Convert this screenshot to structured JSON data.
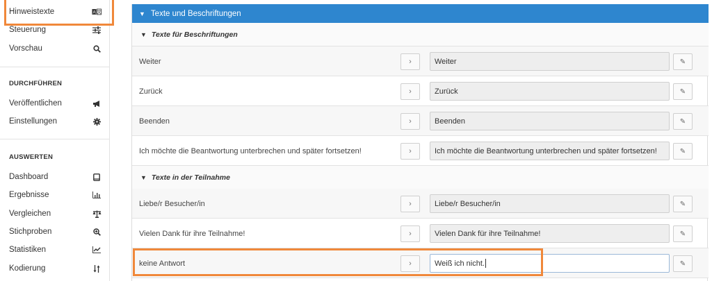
{
  "sidebar": {
    "items_top": [
      {
        "label": "Hinweistexte",
        "icon": "translate-icon",
        "glyph": "A̲Ᾰ"
      },
      {
        "label": "Steuerung",
        "icon": "sliders-icon",
        "glyph": "☰"
      },
      {
        "label": "Vorschau",
        "icon": "search-icon",
        "glyph": "⚲"
      }
    ],
    "section_run": "DURCHFÜHREN",
    "items_run": [
      {
        "label": "Veröffentlichen",
        "icon": "megaphone-icon",
        "glyph": "◀"
      },
      {
        "label": "Einstellungen",
        "icon": "gear-icon",
        "glyph": "✱"
      }
    ],
    "section_eval": "AUSWERTEN",
    "items_eval": [
      {
        "label": "Dashboard",
        "icon": "tablet-icon",
        "glyph": "▭"
      },
      {
        "label": "Ergebnisse",
        "icon": "bar-chart-icon",
        "glyph": "▙"
      },
      {
        "label": "Vergleichen",
        "icon": "scale-icon",
        "glyph": "⚖"
      },
      {
        "label": "Stichproben",
        "icon": "zoom-in-icon",
        "glyph": "⊕"
      },
      {
        "label": "Statistiken",
        "icon": "line-chart-icon",
        "glyph": "⌇"
      },
      {
        "label": "Kodierung",
        "icon": "sort-icon",
        "glyph": "⇅"
      }
    ]
  },
  "panel": {
    "title": "Texte und Beschriftungen",
    "groups": [
      {
        "title": "Texte für Beschriftungen",
        "rows": [
          {
            "label": "Weiter",
            "value": "Weiter"
          },
          {
            "label": "Zurück",
            "value": "Zurück"
          },
          {
            "label": "Beenden",
            "value": "Beenden"
          },
          {
            "label": "Ich möchte die Beantwortung unterbrechen und später fortsetzen!",
            "value": "Ich möchte die Beantwortung unterbrechen und später fortsetzen!"
          }
        ]
      },
      {
        "title": "Texte in der Teilnahme",
        "rows": [
          {
            "label": "Liebe/r Besucher/in",
            "value": "Liebe/r Besucher/in"
          },
          {
            "label": "Vielen Dank für ihre Teilnahme!",
            "value": "Vielen Dank für ihre Teilnahme!"
          },
          {
            "label": "keine Antwort",
            "value": "Weiß ich nicht."
          }
        ]
      }
    ],
    "arrow_glyph": "›",
    "edit_glyph": "✎",
    "collapse_glyph": "▼"
  },
  "colors": {
    "header_blue": "#2e86cf",
    "highlight_orange": "#f0883a"
  }
}
